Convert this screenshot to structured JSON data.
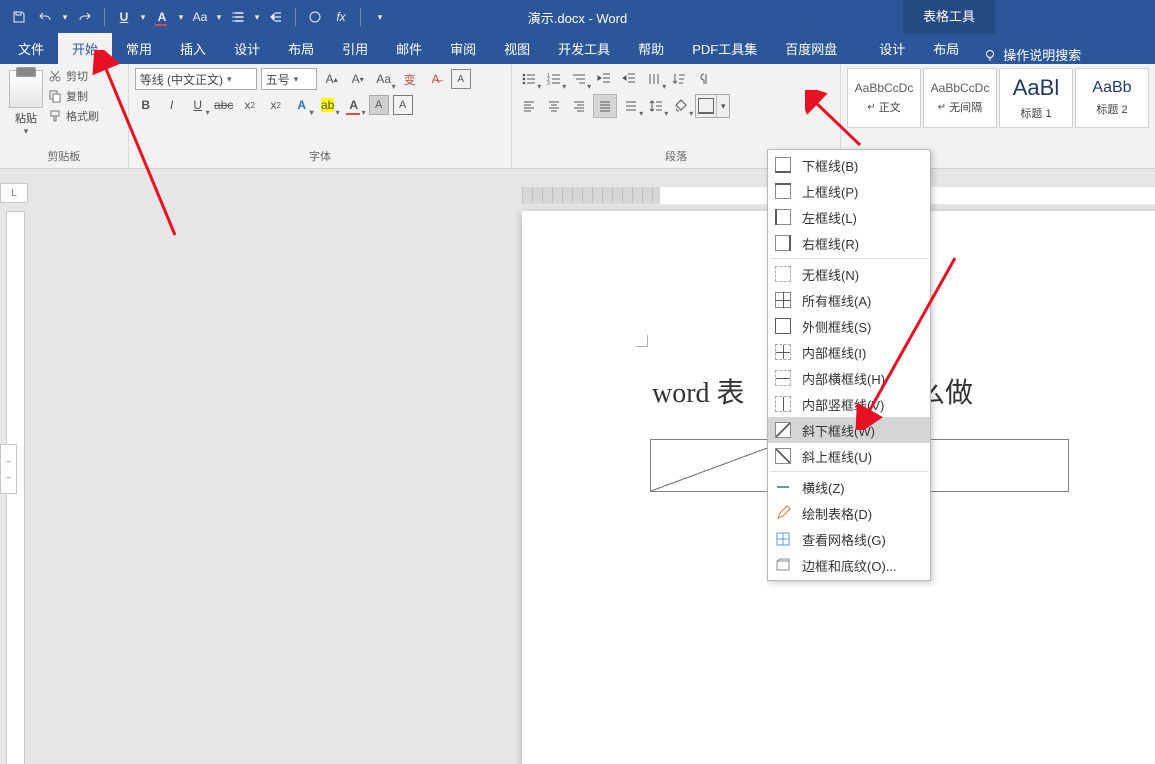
{
  "title": "演示.docx - Word",
  "table_tools": "表格工具",
  "tabs": {
    "file": "文件",
    "home": "开始",
    "common": "常用",
    "insert": "插入",
    "design": "设计",
    "layout": "布局",
    "references": "引用",
    "mailings": "邮件",
    "review": "审阅",
    "view": "视图",
    "developer": "开发工具",
    "help": "帮助",
    "pdf": "PDF工具集",
    "baidu": "百度网盘",
    "tdesign": "设计",
    "tlayout": "布局"
  },
  "tell_me": "操作说明搜索",
  "clipboard": {
    "paste": "粘贴",
    "cut": "剪切",
    "copy": "复制",
    "format_painter": "格式刷",
    "group": "剪贴板"
  },
  "font": {
    "name": "等线 (中文正文)",
    "size": "五号",
    "group": "字体"
  },
  "paragraph": {
    "group": "段落"
  },
  "styles": {
    "normal_preview": "AaBbCcDc",
    "normal": "正文",
    "nospace_preview": "AaBbCcDc",
    "nospace": "无间隔",
    "h1_preview": "AaBl",
    "h1": "标题 1",
    "h2_preview": "AaBb",
    "h2": "标题 2"
  },
  "doc": {
    "text_left": "word 表",
    "text_right": "么做"
  },
  "menu": {
    "bottom": "下框线(B)",
    "top": "上框线(P)",
    "left": "左框线(L)",
    "right": "右框线(R)",
    "none": "无框线(N)",
    "all": "所有框线(A)",
    "outside": "外侧框线(S)",
    "inside": "内部框线(I)",
    "ih": "内部横框线(H)",
    "iv": "内部竖框线(V)",
    "diagd": "斜下框线(W)",
    "diagu": "斜上框线(U)",
    "hline": "横线(Z)",
    "draw": "绘制表格(D)",
    "grid": "查看网格线(G)",
    "shading": "边框和底纹(O)..."
  }
}
